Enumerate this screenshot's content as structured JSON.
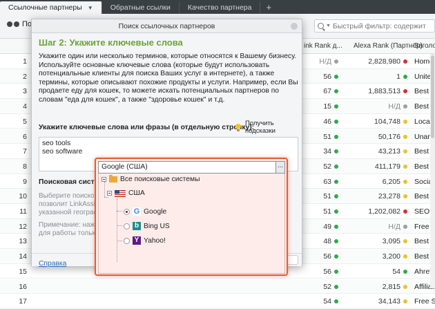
{
  "tabs": [
    {
      "label": "Ссылочные партнеры"
    },
    {
      "label": "Обратные ссылки"
    },
    {
      "label": "Качество партнера"
    }
  ],
  "tab_plus": "+",
  "toolbar": {
    "search_label": "Пои"
  },
  "filter": {
    "placeholder": "Быстрый фильтр: содержит"
  },
  "columns": {
    "link_rank": "ink Rank д...",
    "alexa": "Alexa Rank (Партнёр)",
    "page": "Заголов"
  },
  "rows": [
    {
      "num": "1",
      "lr": "Н/Д",
      "lr_color": "#9aa0a4",
      "alexa": "2,828,980",
      "alexa_color": "#d0342c",
      "page": "Home |"
    },
    {
      "num": "2",
      "lr": "56",
      "lr_color": "#2eaa4a",
      "alexa": "1",
      "alexa_color": "#2eaa4a",
      "page": "United"
    },
    {
      "num": "3",
      "lr": "67",
      "lr_color": "#2eaa4a",
      "alexa": "1,883,513",
      "alexa_color": "#d0342c",
      "page": "Best S"
    },
    {
      "num": "4",
      "lr": "15",
      "lr_color": "#2eaa4a",
      "alexa": "Н/Д",
      "alexa_color": "#9aa0a4",
      "page": "Best Se"
    },
    {
      "num": "5",
      "lr": "46",
      "lr_color": "#2eaa4a",
      "alexa": "104,748",
      "alexa_color": "#e8c42a",
      "page": "Local SE"
    },
    {
      "num": "6",
      "lr": "51",
      "lr_color": "#2eaa4a",
      "alexa": "50,176",
      "alexa_color": "#e8c42a",
      "page": "Unamo"
    },
    {
      "num": "7",
      "lr": "34",
      "lr_color": "#2eaa4a",
      "alexa": "43,213",
      "alexa_color": "#e8c42a",
      "page": "Best SE"
    },
    {
      "num": "8",
      "lr": "52",
      "lr_color": "#2eaa4a",
      "alexa": "411,179",
      "alexa_color": "#e8c42a",
      "page": "Best SE"
    },
    {
      "num": "9",
      "lr": "63",
      "lr_color": "#2eaa4a",
      "alexa": "6,205",
      "alexa_color": "#e8c42a",
      "page": "Social M"
    },
    {
      "num": "10",
      "lr": "51",
      "lr_color": "#2eaa4a",
      "alexa": "23,278",
      "alexa_color": "#e8c42a",
      "page": "Best SE"
    },
    {
      "num": "11",
      "lr": "51",
      "lr_color": "#2eaa4a",
      "alexa": "1,202,082",
      "alexa_color": "#d0342c",
      "page": "SEO too"
    },
    {
      "num": "12",
      "lr": "49",
      "lr_color": "#2eaa4a",
      "alexa": "Н/Д",
      "alexa_color": "#9aa0a4",
      "page": "Free S"
    },
    {
      "num": "13",
      "lr": "48",
      "lr_color": "#2eaa4a",
      "alexa": "3,095",
      "alexa_color": "#e8c42a",
      "page": "Best SE"
    },
    {
      "num": "14",
      "lr": "56",
      "lr_color": "#2eaa4a",
      "alexa": "3,200",
      "alexa_color": "#e8c42a",
      "page": "Best SE"
    },
    {
      "num": "15",
      "lr": "56",
      "lr_color": "#2eaa4a",
      "alexa": "54",
      "alexa_color": "#2eaa4a",
      "page": "Ahrefs:"
    },
    {
      "num": "16",
      "lr": "52",
      "lr_color": "#2eaa4a",
      "alexa": "2,815",
      "alexa_color": "#e8c42a",
      "page": "Affiliate"
    },
    {
      "num": "17",
      "lr": "54",
      "lr_color": "#2eaa4a",
      "alexa": "34,143",
      "alexa_color": "#e8c42a",
      "page": "Free SE"
    }
  ],
  "bg_url": "https://www.sitebuilder...",
  "dialog": {
    "title": "Поиск ссылочных партнеров",
    "step": "Шаг 2: Укажите ключевые слова",
    "description": "Укажите один или несколько терминов, которые относятся к  Вашему бизнесу. Используйте основные ключевые слова (которые будут использовать потенциальные клиенты для поиска Ваших услуг в интернете), а также термины, которые описывают похожие продукты и услуги. Например, если Вы продаете еду для кошек, то можете искать потенциальных партнеров по словам \"еда для кошек\", а также \"здоровье кошек\" и т.д.",
    "keywords_label": "Укажите ключевые слова или фразы (в отдельную строчку):",
    "hints_label": "Получить подсказки",
    "keywords": [
      "seo tools",
      "seo software"
    ],
    "search_engine_label": "Поисковая система",
    "gray_text_1": "Выберите поисковую позволит LinkAssista указанной географич",
    "gray_text_2": "Примечание: нажми для работы только",
    "help_link": "Справка"
  },
  "dropdown": {
    "selected": "Google (США)",
    "ellipsis": "...",
    "tree": {
      "root": "Все поисковые системы",
      "country": "США",
      "engines": [
        {
          "label": "Google",
          "icon": "google-icon",
          "selected": true
        },
        {
          "label": "Bing US",
          "icon": "bing-icon",
          "selected": false
        },
        {
          "label": "Yahoo!",
          "icon": "yahoo-icon",
          "selected": false
        }
      ]
    }
  }
}
